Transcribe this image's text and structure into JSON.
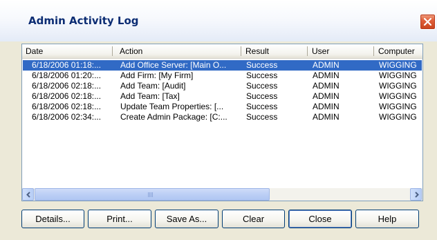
{
  "window": {
    "title": "Admin Activity Log"
  },
  "columns": [
    "Date",
    "Action",
    "Result",
    "User",
    "Computer"
  ],
  "rows": [
    {
      "date": "6/18/2006 01:18:...",
      "action": "Add Office Server: [Main O...",
      "result": "Success",
      "user": "ADMIN",
      "computer": "WIGGING",
      "selected": true
    },
    {
      "date": "6/18/2006 01:20:...",
      "action": "Add Firm: [My Firm]",
      "result": "Success",
      "user": "ADMIN",
      "computer": "WIGGING",
      "selected": false
    },
    {
      "date": "6/18/2006 02:18:...",
      "action": "Add Team: [Audit]",
      "result": "Success",
      "user": "ADMIN",
      "computer": "WIGGING",
      "selected": false
    },
    {
      "date": "6/18/2006 02:18:...",
      "action": "Add Team: [Tax]",
      "result": "Success",
      "user": "ADMIN",
      "computer": "WIGGING",
      "selected": false
    },
    {
      "date": "6/18/2006 02:18:...",
      "action": "Update Team Properties: [...",
      "result": "Success",
      "user": "ADMIN",
      "computer": "WIGGING",
      "selected": false
    },
    {
      "date": "6/18/2006 02:34:...",
      "action": "Create Admin Package: [C:...",
      "result": "Success",
      "user": "ADMIN",
      "computer": "WIGGING",
      "selected": false
    }
  ],
  "buttons": {
    "details": "Details...",
    "print": "Print...",
    "save_as": "Save As...",
    "clear": "Clear",
    "close": "Close",
    "help": "Help"
  },
  "icons": {
    "close": "close-icon",
    "scroll_left": "arrow-left-icon",
    "scroll_right": "arrow-right-icon"
  },
  "colors": {
    "selection": "#316AC5",
    "title_text": "#0B2C73",
    "close_button": "#E0603B"
  }
}
